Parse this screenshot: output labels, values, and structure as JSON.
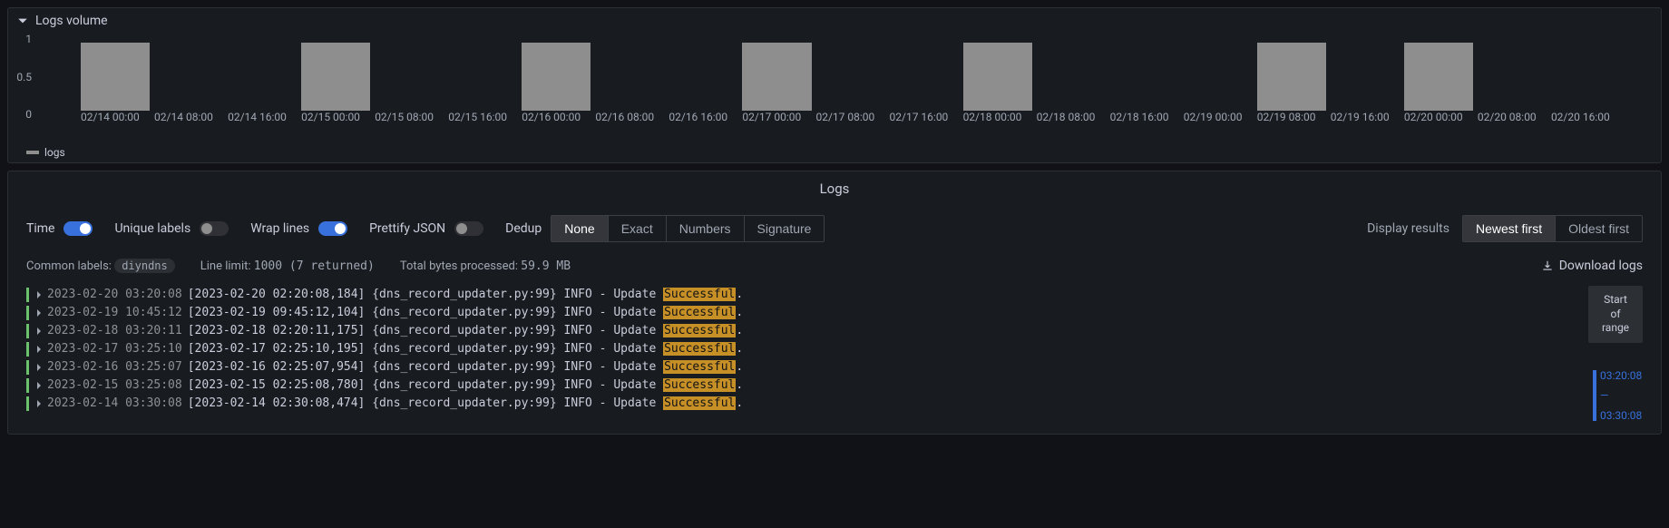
{
  "volume_panel": {
    "title": "Logs volume",
    "legend_label": "logs"
  },
  "chart_data": {
    "type": "bar",
    "xlabel": "",
    "ylabel": "",
    "ylim": [
      0,
      1
    ],
    "yticks": [
      1,
      0.5,
      0
    ],
    "categories": [
      "02/14 00:00",
      "02/14 08:00",
      "02/14 16:00",
      "02/15 00:00",
      "02/15 08:00",
      "02/15 16:00",
      "02/16 00:00",
      "02/16 08:00",
      "02/16 16:00",
      "02/17 00:00",
      "02/17 08:00",
      "02/17 16:00",
      "02/18 00:00",
      "02/18 08:00",
      "02/18 16:00",
      "02/19 00:00",
      "02/19 08:00",
      "02/19 16:00",
      "02/20 00:00",
      "02/20 08:00",
      "02/20 16:00"
    ],
    "series": [
      {
        "name": "logs",
        "values": [
          1,
          0,
          0,
          1,
          0,
          0,
          1,
          0,
          0,
          1,
          0,
          0,
          1,
          0,
          0,
          0,
          1,
          0,
          1,
          0,
          0
        ]
      }
    ]
  },
  "logs_panel": {
    "title": "Logs",
    "controls": {
      "time_label": "Time",
      "time_on": true,
      "unique_labels_label": "Unique labels",
      "unique_labels_on": false,
      "wrap_lines_label": "Wrap lines",
      "wrap_lines_on": true,
      "prettify_json_label": "Prettify JSON",
      "prettify_json_on": false,
      "dedup_label": "Dedup",
      "dedup_options": [
        "None",
        "Exact",
        "Numbers",
        "Signature"
      ],
      "dedup_selected": "None",
      "display_results_label": "Display results",
      "order_options": [
        "Newest first",
        "Oldest first"
      ],
      "order_selected": "Newest first"
    },
    "meta": {
      "common_labels_label": "Common labels:",
      "common_labels_value": "diyndns",
      "line_limit_label": "Line limit:",
      "line_limit_value": "1000 (7 returned)",
      "bytes_label": "Total bytes processed:",
      "bytes_value": "59.9 MB",
      "download_label": "Download logs"
    },
    "range_badge": {
      "l1": "Start",
      "l2": "of",
      "l3": "range"
    },
    "time_range": {
      "top": "03:20:08",
      "mid": "—",
      "bot": "03:30:08"
    },
    "highlight": "Successful",
    "entries": [
      {
        "ts": "2023-02-20 03:20:08",
        "pre": "[2023-02-20 02:20:08,184] {dns_record_updater.py:99} INFO - Update ",
        "post": "."
      },
      {
        "ts": "2023-02-19 10:45:12",
        "pre": "[2023-02-19 09:45:12,104] {dns_record_updater.py:99} INFO - Update ",
        "post": "."
      },
      {
        "ts": "2023-02-18 03:20:11",
        "pre": "[2023-02-18 02:20:11,175] {dns_record_updater.py:99} INFO - Update ",
        "post": "."
      },
      {
        "ts": "2023-02-17 03:25:10",
        "pre": "[2023-02-17 02:25:10,195] {dns_record_updater.py:99} INFO - Update ",
        "post": "."
      },
      {
        "ts": "2023-02-16 03:25:07",
        "pre": "[2023-02-16 02:25:07,954] {dns_record_updater.py:99} INFO - Update ",
        "post": "."
      },
      {
        "ts": "2023-02-15 03:25:08",
        "pre": "[2023-02-15 02:25:08,780] {dns_record_updater.py:99} INFO - Update ",
        "post": "."
      },
      {
        "ts": "2023-02-14 03:30:08",
        "pre": "[2023-02-14 02:30:08,474] {dns_record_updater.py:99} INFO - Update ",
        "post": "."
      }
    ]
  }
}
